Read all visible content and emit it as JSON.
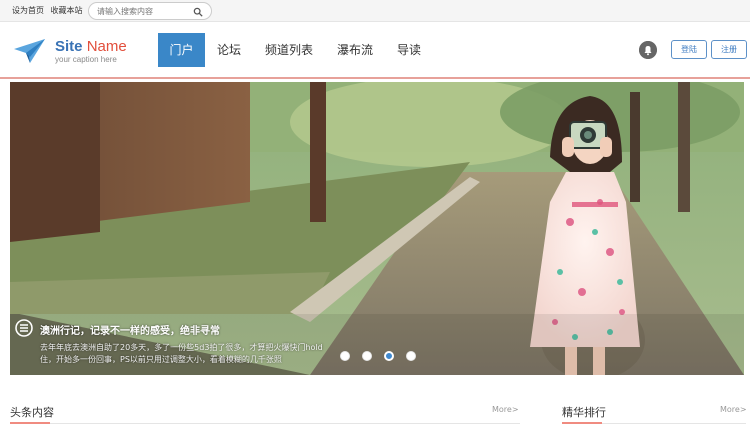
{
  "topbar": {
    "links": [
      "设为首页",
      "收藏本站"
    ],
    "search_placeholder": "请输入搜索内容"
  },
  "brand": {
    "name_part1": "Site",
    "name_part2": "Name",
    "caption": "your caption here"
  },
  "nav": {
    "items": [
      "门户",
      "论坛",
      "频道列表",
      "瀑布流",
      "导读"
    ],
    "active": "门户"
  },
  "auth": {
    "login": "登陆",
    "register": "注册"
  },
  "slider": {
    "title": "澳洲行记，记录不一样的感受，绝非寻常",
    "text": "去年年底去澳洲自助了20多天，多了一份些5d3拍了很多，才算把火爆快门hold住，开始多一份回事，PS以前只用过调整大小，看着模糊的几千张照",
    "dots": 4,
    "active_dot": 3
  },
  "sections": {
    "left_title": "头条内容",
    "left_more": "More>",
    "right_title": "精华排行",
    "right_more": "More>"
  },
  "colors": {
    "brand_blue": "#3a87c8",
    "brand_red": "#e24f3c",
    "accent_underline": "#f08b80"
  }
}
